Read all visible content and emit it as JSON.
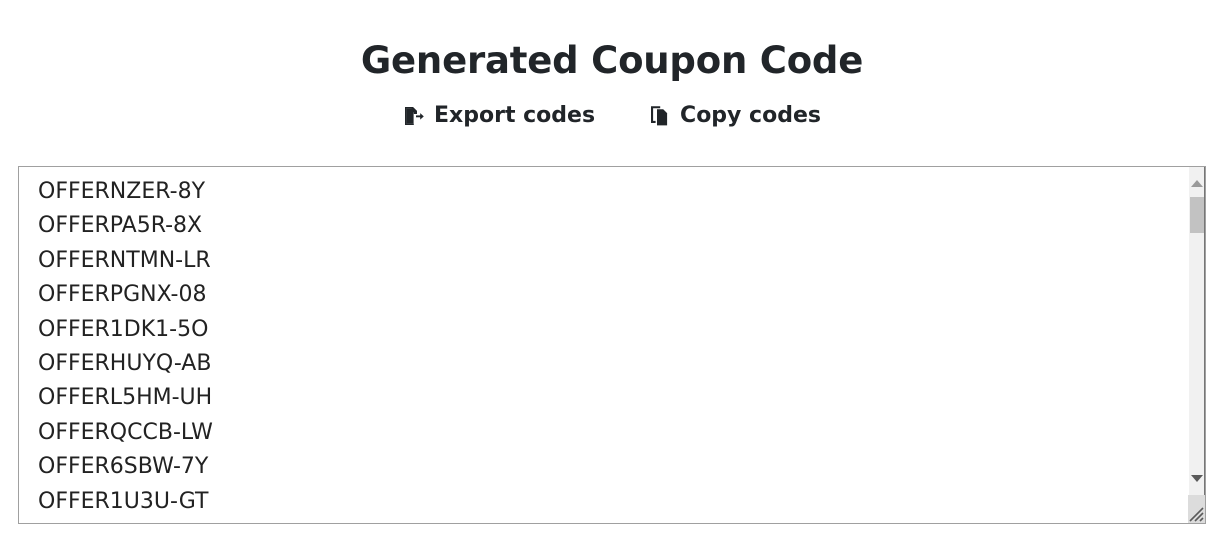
{
  "page": {
    "title": "Generated Coupon Code",
    "background_color": "#ffffff",
    "text_color": "#212529"
  },
  "actions": [
    {
      "label": "Export codes",
      "icon": "file-export-icon"
    },
    {
      "label": "Copy codes",
      "icon": "copy-icon"
    }
  ],
  "codes_box": {
    "border_color": "#a0a0a0",
    "codes": [
      "OFFERNZER-8Y",
      "OFFERPA5R-8X",
      "OFFERNTMN-LR",
      "OFFERPGNX-08",
      "OFFER1DK1-5O",
      "OFFERHUYQ-AB",
      "OFFERL5HM-UH",
      "OFFERQCCB-LW",
      "OFFER6SBW-7Y",
      "OFFER1U3U-GT"
    ]
  },
  "scrollbar": {
    "track_color": "#f1f1f1",
    "thumb_color": "#c2c2c2",
    "up_arrow_icon": "chevron-up-icon",
    "down_arrow_icon": "chevron-down-icon",
    "resize_grip_icon": "resize-grip-icon"
  }
}
